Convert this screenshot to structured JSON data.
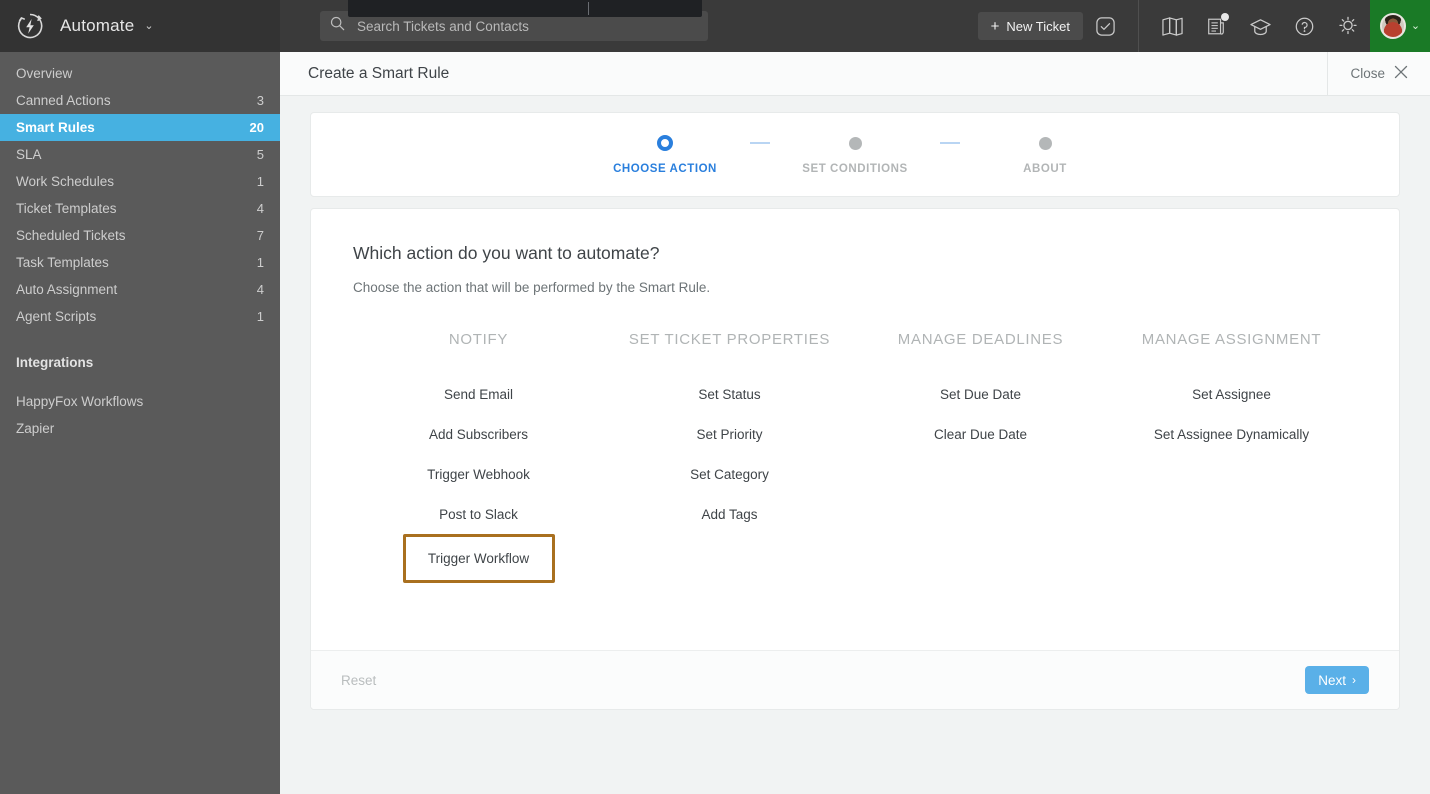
{
  "topbar": {
    "brand": "Automate",
    "brand_caret": "⌄",
    "logo_icon": "automate-bolt-circle-icon",
    "search": {
      "placeholder": "Search Tickets and Contacts",
      "value": "",
      "icon": "search-icon"
    },
    "new_ticket": {
      "label": "New Ticket",
      "plus": "+"
    },
    "icons": [
      {
        "name": "checkbox-square-icon"
      },
      {
        "name": "book-open-icon"
      },
      {
        "name": "news-feed-icon",
        "has_badge": true
      },
      {
        "name": "graduation-cap-icon"
      },
      {
        "name": "help-circle-icon"
      },
      {
        "name": "lightbulb-icon"
      }
    ],
    "avatar": {
      "name": "user-avatar",
      "caret": "⌄",
      "bg": "#1a7a26"
    }
  },
  "sidebar": {
    "items": [
      {
        "label": "Overview",
        "count": "",
        "active": false
      },
      {
        "label": "Canned Actions",
        "count": "3",
        "active": false
      },
      {
        "label": "Smart Rules",
        "count": "20",
        "active": true
      },
      {
        "label": "SLA",
        "count": "5",
        "active": false
      },
      {
        "label": "Work Schedules",
        "count": "1",
        "active": false
      },
      {
        "label": "Ticket Templates",
        "count": "4",
        "active": false
      },
      {
        "label": "Scheduled Tickets",
        "count": "7",
        "active": false
      },
      {
        "label": "Task Templates",
        "count": "1",
        "active": false
      },
      {
        "label": "Auto Assignment",
        "count": "4",
        "active": false
      },
      {
        "label": "Agent Scripts",
        "count": "1",
        "active": false
      }
    ],
    "integrations_heading": "Integrations",
    "integrations": [
      {
        "label": "HappyFox Workflows"
      },
      {
        "label": "Zapier"
      }
    ],
    "active_color": "#46b1e1"
  },
  "page": {
    "title": "Create a Smart Rule",
    "close_label": "Close",
    "close_icon": "close-x-icon"
  },
  "stepper": {
    "steps": [
      {
        "label": "CHOOSE ACTION",
        "active": true
      },
      {
        "label": "SET CONDITIONS",
        "active": false
      },
      {
        "label": "ABOUT",
        "active": false
      }
    ],
    "active_color": "#2a7fdd",
    "inactive_color": "#b4b7b8"
  },
  "main": {
    "question": "Which action do you want to automate?",
    "subtitle": "Choose the action that will be performed by the Smart Rule.",
    "columns": [
      {
        "heading": "NOTIFY",
        "actions": [
          {
            "label": "Send Email",
            "selected": false
          },
          {
            "label": "Add Subscribers",
            "selected": false
          },
          {
            "label": "Trigger Webhook",
            "selected": false
          },
          {
            "label": "Post to Slack",
            "selected": false
          },
          {
            "label": "Trigger Workflow",
            "selected": true
          }
        ]
      },
      {
        "heading": "SET TICKET PROPERTIES",
        "actions": [
          {
            "label": "Set Status",
            "selected": false
          },
          {
            "label": "Set Priority",
            "selected": false
          },
          {
            "label": "Set Category",
            "selected": false
          },
          {
            "label": "Add Tags",
            "selected": false
          }
        ]
      },
      {
        "heading": "MANAGE DEADLINES",
        "actions": [
          {
            "label": "Set Due Date",
            "selected": false
          },
          {
            "label": "Clear Due Date",
            "selected": false
          }
        ]
      },
      {
        "heading": "MANAGE ASSIGNMENT",
        "actions": [
          {
            "label": "Set Assignee",
            "selected": false
          },
          {
            "label": "Set Assignee Dynamically",
            "selected": false
          }
        ]
      }
    ],
    "selection_border_color": "#a9701f"
  },
  "footer": {
    "reset_label": "Reset",
    "next_label": "Next",
    "next_chevron": "›",
    "next_color": "#5ab0e8"
  }
}
